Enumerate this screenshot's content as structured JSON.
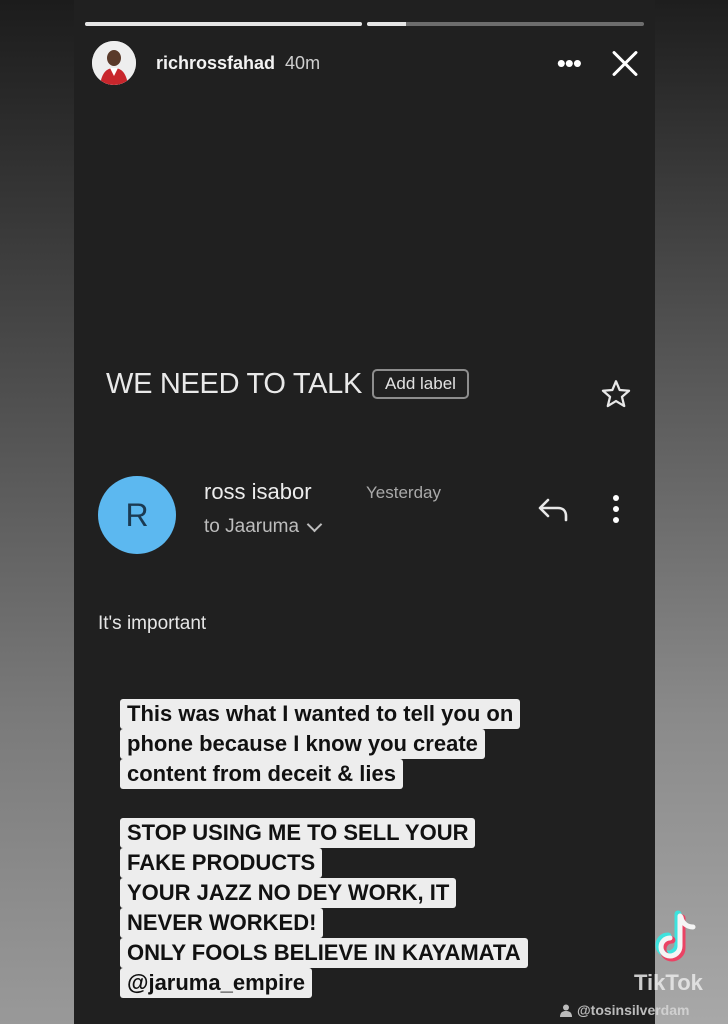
{
  "story": {
    "progress": [
      1.0,
      0.14
    ],
    "username": "richrossfahad",
    "time": "40m",
    "more_label": "•••"
  },
  "email": {
    "subject": "WE NEED TO TALK",
    "add_label": "Add label",
    "sender_initial": "R",
    "sender_name": "ross isabor",
    "sender_date": "Yesterday",
    "recipient": "to Jaaruma",
    "body": "It's important"
  },
  "overlay_text": {
    "block1": [
      "This was what I wanted to tell you on",
      "phone because I know you create",
      "content from deceit & lies"
    ],
    "block2": [
      "STOP USING ME TO SELL YOUR",
      "FAKE PRODUCTS",
      "YOUR JAZZ NO DEY WORK, IT",
      "NEVER WORKED!",
      "ONLY FOOLS BELIEVE IN KAYAMATA",
      "@jaruma_empire"
    ]
  },
  "watermark": {
    "brand": "TikTok",
    "handle": "@tosinsilverdam"
  },
  "colors": {
    "sender_avatar": "#5cb8f0",
    "story_bg": "#202020",
    "overlay_bg": "#ededed"
  }
}
